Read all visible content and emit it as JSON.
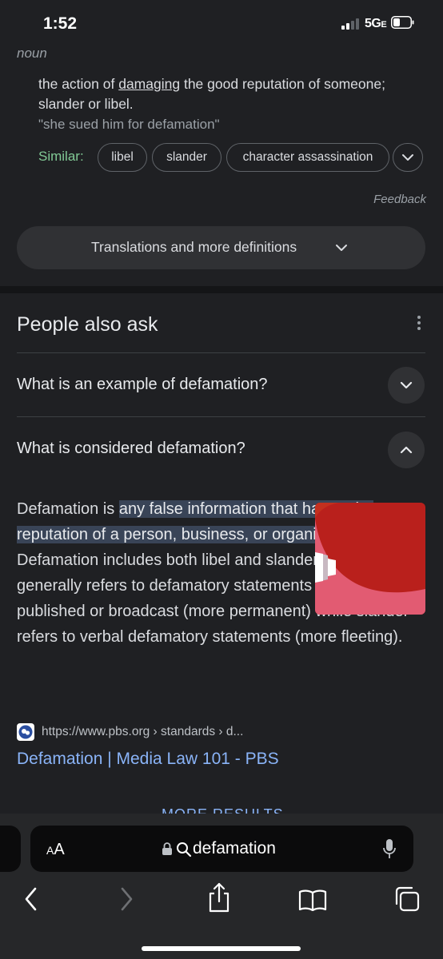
{
  "status_bar": {
    "time": "1:52",
    "network": "5G",
    "network_suffix": "E"
  },
  "dictionary": {
    "part_of_speech": "noun",
    "definition_before": "the action of ",
    "definition_link": "damaging",
    "definition_after": " the good reputation of someone; slander or libel.",
    "example": "\"she sued him for defamation\"",
    "similar_label": "Similar:",
    "similar": [
      "libel",
      "slander",
      "character assassination"
    ],
    "feedback": "Feedback",
    "translations_button": "Translations and more definitions"
  },
  "people_also_ask": {
    "title": "People also ask",
    "questions": [
      {
        "text": "What is an example of defamation?",
        "expanded": false
      },
      {
        "text": "What is considered defamation?",
        "expanded": true
      }
    ],
    "answer": {
      "lead": "Defamation is ",
      "highlight": "any false information that harms the reputation of a person, business, or organization",
      "rest": ". Defamation includes both libel and slander. Libel generally refers to defamatory statements that are published or broadcast (more permanent) while slander refers to verbal defamatory statements (more fleeting)."
    },
    "source": {
      "url": "https://www.pbs.org › standards › d...",
      "title": "Defamation | Media Law 101 - PBS"
    }
  },
  "more_results": "MORE RESULTS",
  "browser": {
    "aa_label_big": "A",
    "aa_label_small": "A",
    "url_text": "defamation"
  },
  "colors": {
    "background": "#1f2023",
    "link_blue": "#8ab4f8",
    "similar_green": "#81c995",
    "highlight": "#394457"
  },
  "icons": [
    "chevron-down-icon",
    "chevron-up-icon",
    "more-vert-icon",
    "lock-icon",
    "search-icon",
    "mic-icon",
    "back-icon",
    "forward-icon",
    "share-icon",
    "bookmarks-icon",
    "tabs-icon"
  ]
}
